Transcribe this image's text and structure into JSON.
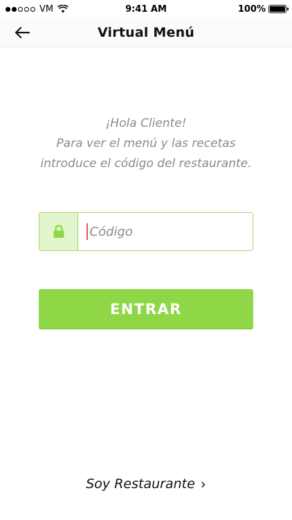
{
  "status_bar": {
    "carrier": "VM",
    "time": "9:41 AM",
    "battery_label": "100%",
    "battery_level": 1.0,
    "signal_bars_filled": 2,
    "signal_bars_total": 5
  },
  "nav": {
    "title": "Virtual Menú",
    "back_icon": "arrow-left-icon"
  },
  "greeting": {
    "line1": "¡Hola Cliente!",
    "line2": "Para ver el menú y las recetas",
    "line3": "introduce el código del restaurante."
  },
  "code_field": {
    "placeholder": "Código",
    "value": "",
    "icon": "lock-icon"
  },
  "enter_button": {
    "label": "ENTRAR"
  },
  "restaurant_link": {
    "label": "Soy Restaurante",
    "chevron": "›"
  },
  "colors": {
    "accent": "#8fd747",
    "field_border": "#a5d86a",
    "field_icon_bg": "#e3f5cd",
    "greeting_text": "#8a8a8a",
    "caret": "#e45757"
  }
}
